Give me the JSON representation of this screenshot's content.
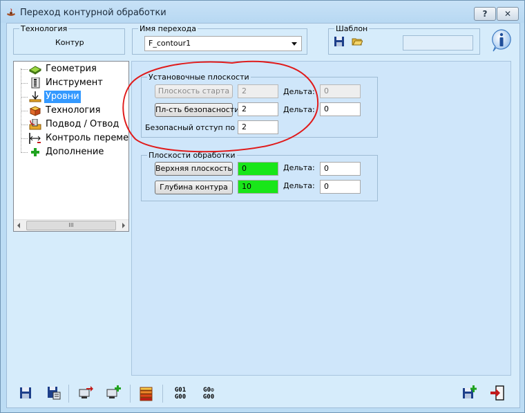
{
  "window": {
    "title": "Переход контурной обработки",
    "help_label": "?",
    "close_label": "✕"
  },
  "header": {
    "technology_group": "Технология",
    "technology_value": "Контур",
    "name_group": "Имя перехода",
    "name_value": "F_contour1",
    "template_group": "Шаблон",
    "template_field_value": ""
  },
  "tree": {
    "items": [
      {
        "label": "Геометрия",
        "icon": "geometry-icon"
      },
      {
        "label": "Инструмент",
        "icon": "tool-icon"
      },
      {
        "label": "Уровни",
        "icon": "levels-icon",
        "selected": true
      },
      {
        "label": "Технология",
        "icon": "technology-icon"
      },
      {
        "label": "Подвод / Отвод",
        "icon": "approach-retract-icon"
      },
      {
        "label": "Контроль перемещ",
        "icon": "motion-control-icon"
      },
      {
        "label": "Дополнение",
        "icon": "add-icon"
      }
    ],
    "scroll_thumb": "III"
  },
  "setup_planes": {
    "title": "Установочные плоскости",
    "start_plane_button": "Плоскость старта",
    "start_plane_value": "2",
    "start_delta_label": "Дельта:",
    "start_delta_value": "0",
    "safety_plane_button": "Пл-сть безопасности",
    "safety_plane_value": "2",
    "safety_delta_label": "Дельта:",
    "safety_delta_value": "0",
    "safe_offset_label": "Безопасный отступ по Z:",
    "safe_offset_value": "2"
  },
  "machining_planes": {
    "title": "Плоскости обработки",
    "top_plane_button": "Верхняя плоскость",
    "top_plane_value": "0",
    "top_delta_label": "Дельта:",
    "top_delta_value": "0",
    "depth_button": "Глубина контура",
    "depth_value": "10",
    "depth_delta_label": "Дельта:",
    "depth_delta_value": "0"
  },
  "bottom_toolbar": {
    "gcode1_line1": "G01",
    "gcode1_line2": "G00",
    "gcode2_line1": "G0",
    "gcode2_line2": "G00"
  },
  "colors": {
    "window_bg": "#bcdcf4",
    "panel_bg": "#cfe6fa",
    "highlight_field": "#19e619",
    "selection": "#3399ff",
    "annotation": "#e01a1a"
  }
}
